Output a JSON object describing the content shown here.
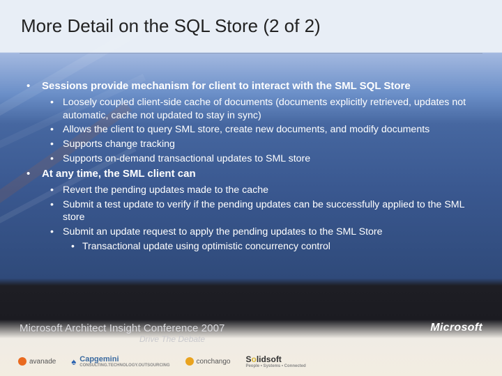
{
  "title": "More Detail on the SQL Store (2 of 2)",
  "topics": [
    {
      "headline": "Sessions provide mechanism for client to interact with the SML SQL Store",
      "items": [
        "Loosely coupled client-side cache of documents (documents explicitly retrieved, updates not automatic, cache not updated to stay in sync)",
        "Allows the client to query SML store, create new documents, and modify documents",
        "Supports change tracking",
        "Supports on-demand transactional updates to SML store"
      ]
    },
    {
      "headline": "At any time, the SML client can",
      "items": [
        "Revert the pending updates made to the cache",
        "Submit a test update to verify if the pending updates can be successfully applied to the SML store",
        {
          "text": "Submit an update request to apply the pending updates to the SML Store",
          "sub": [
            "Transactional update using optimistic concurrency control"
          ]
        }
      ]
    }
  ],
  "footer": {
    "conference": "Microsoft Architect Insight Conference 2007",
    "tagline": "Drive The Debate",
    "brand": "Microsoft"
  },
  "sponsors": {
    "s1": "avanade",
    "s2": "Capgemini",
    "s2sub": "CONSULTING.TECHNOLOGY.OUTSOURCING",
    "s3": "conchango",
    "s4a": "S",
    "s4b": "o",
    "s4c": "lidsoft",
    "s4sub": "People • Systems • Connected"
  }
}
